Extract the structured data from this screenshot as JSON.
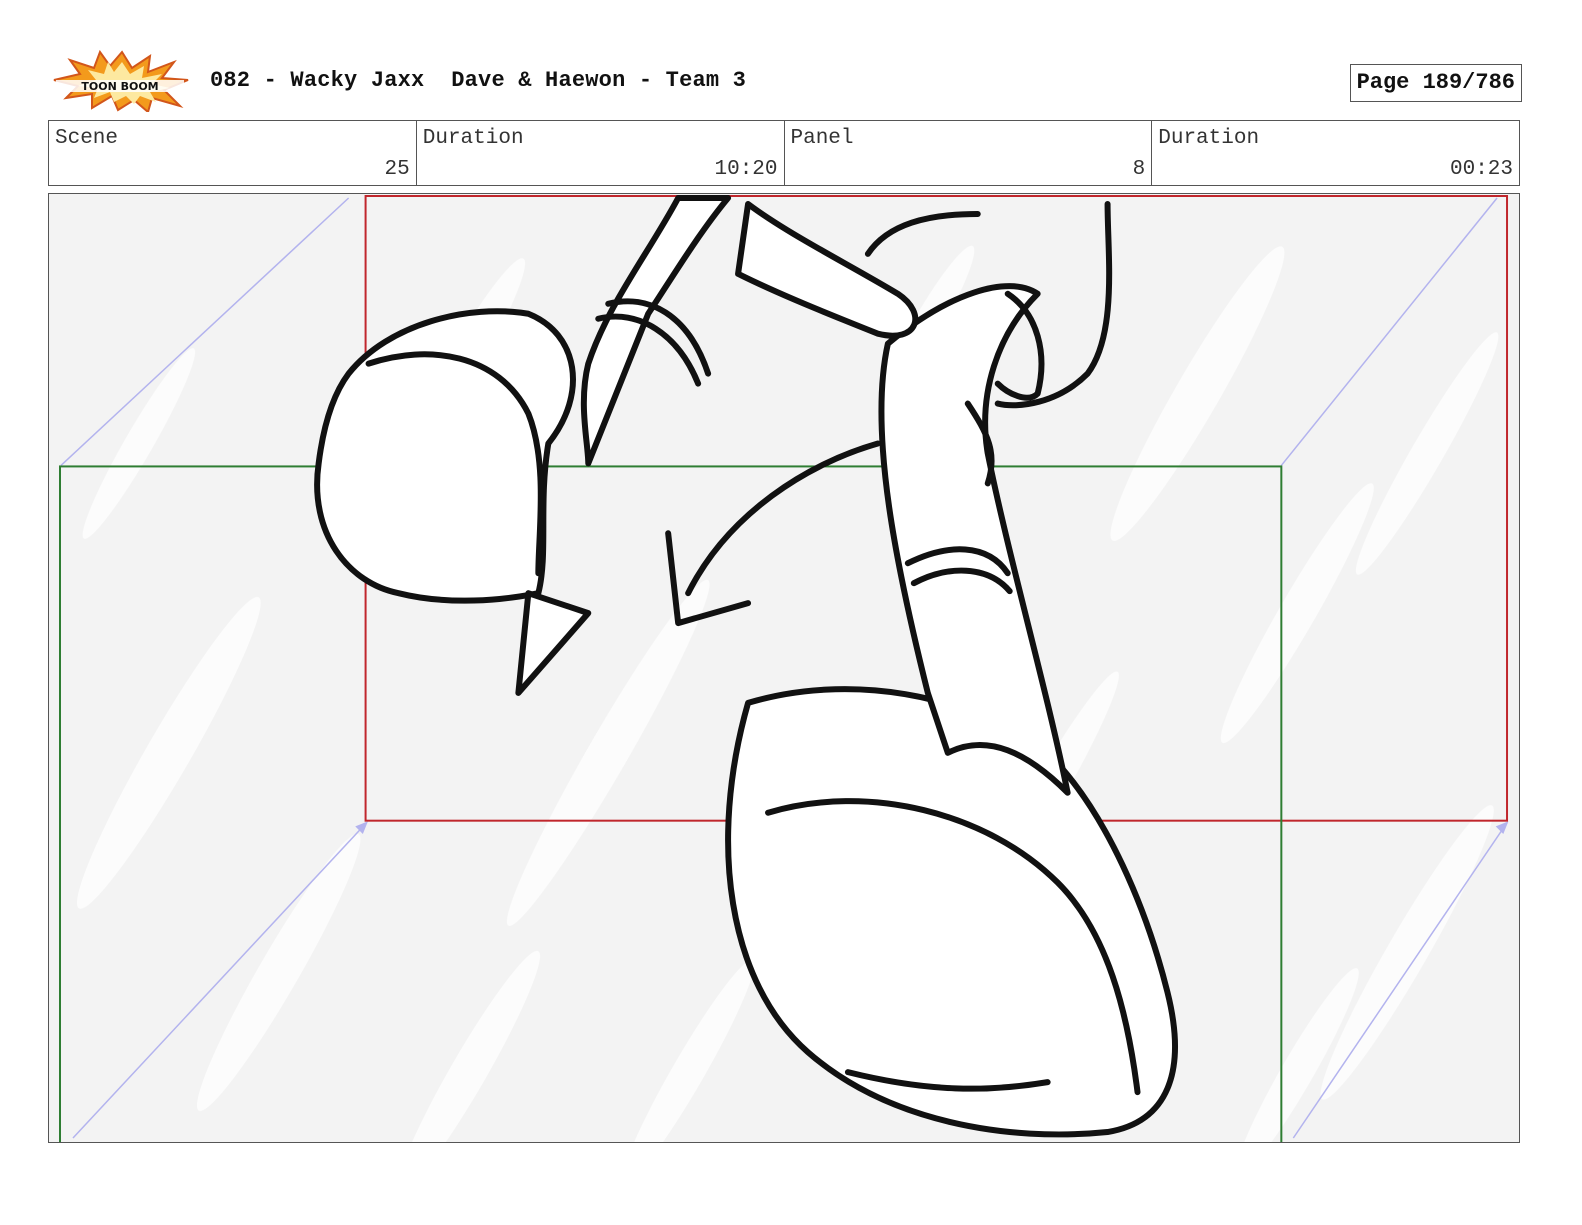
{
  "header": {
    "logo_text": "TOON BOOM",
    "title": "082 - Wacky Jaxx  Dave & Haewon - Team 3",
    "page": "Page 189/786"
  },
  "info": {
    "scene_label": "Scene",
    "scene_value": "25",
    "scene_duration_label": "Duration",
    "scene_duration_value": "10:20",
    "panel_label": "Panel",
    "panel_value": "8",
    "panel_duration_label": "Duration",
    "panel_duration_value": "00:23"
  },
  "colors": {
    "camera_frame_red": "#c0262c",
    "camera_frame_green": "#2e7d32",
    "motion_path": "#b3b3ee",
    "panel_background": "#f3f3f3"
  }
}
